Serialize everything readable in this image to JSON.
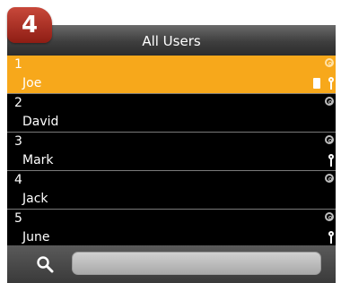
{
  "badge": "4",
  "header": {
    "title": "All Users"
  },
  "users": [
    {
      "id": "1",
      "name": "Joe",
      "selected": true,
      "fingerprint": true,
      "password": true,
      "card": true
    },
    {
      "id": "2",
      "name": "David",
      "selected": false,
      "fingerprint": true,
      "password": false,
      "card": false
    },
    {
      "id": "3",
      "name": "Mark",
      "selected": false,
      "fingerprint": true,
      "password": true,
      "card": false
    },
    {
      "id": "4",
      "name": "Jack",
      "selected": false,
      "fingerprint": true,
      "password": false,
      "card": false
    },
    {
      "id": "5",
      "name": "June",
      "selected": false,
      "fingerprint": true,
      "password": true,
      "card": false
    }
  ],
  "search": {
    "value": "",
    "placeholder": ""
  },
  "icons": {
    "fingerprint": "fingerprint-icon",
    "password": "password-key-icon",
    "card": "card-icon",
    "search": "search-icon"
  },
  "colors": {
    "selected_row": "#f7a81b",
    "badge": "#a8291d",
    "background": "#000000"
  }
}
